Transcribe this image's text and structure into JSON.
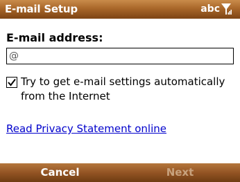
{
  "titlebar": {
    "title": "E-mail Setup",
    "input_mode": "abc",
    "signal_icon": "signal-strength-icon"
  },
  "form": {
    "email_label": "E-mail address:",
    "email_value": "@",
    "auto_settings_checked": true,
    "auto_settings_label": "Try to get e-mail settings automatically from the Internet",
    "privacy_link": "Read Privacy Statement online"
  },
  "softkeys": {
    "left": "Cancel",
    "right": "Next",
    "right_enabled": false
  },
  "colors": {
    "titlebar": "#a9672a",
    "softbar": "#935424",
    "link": "#0000cc",
    "disabled_text": "#c8a27d"
  }
}
